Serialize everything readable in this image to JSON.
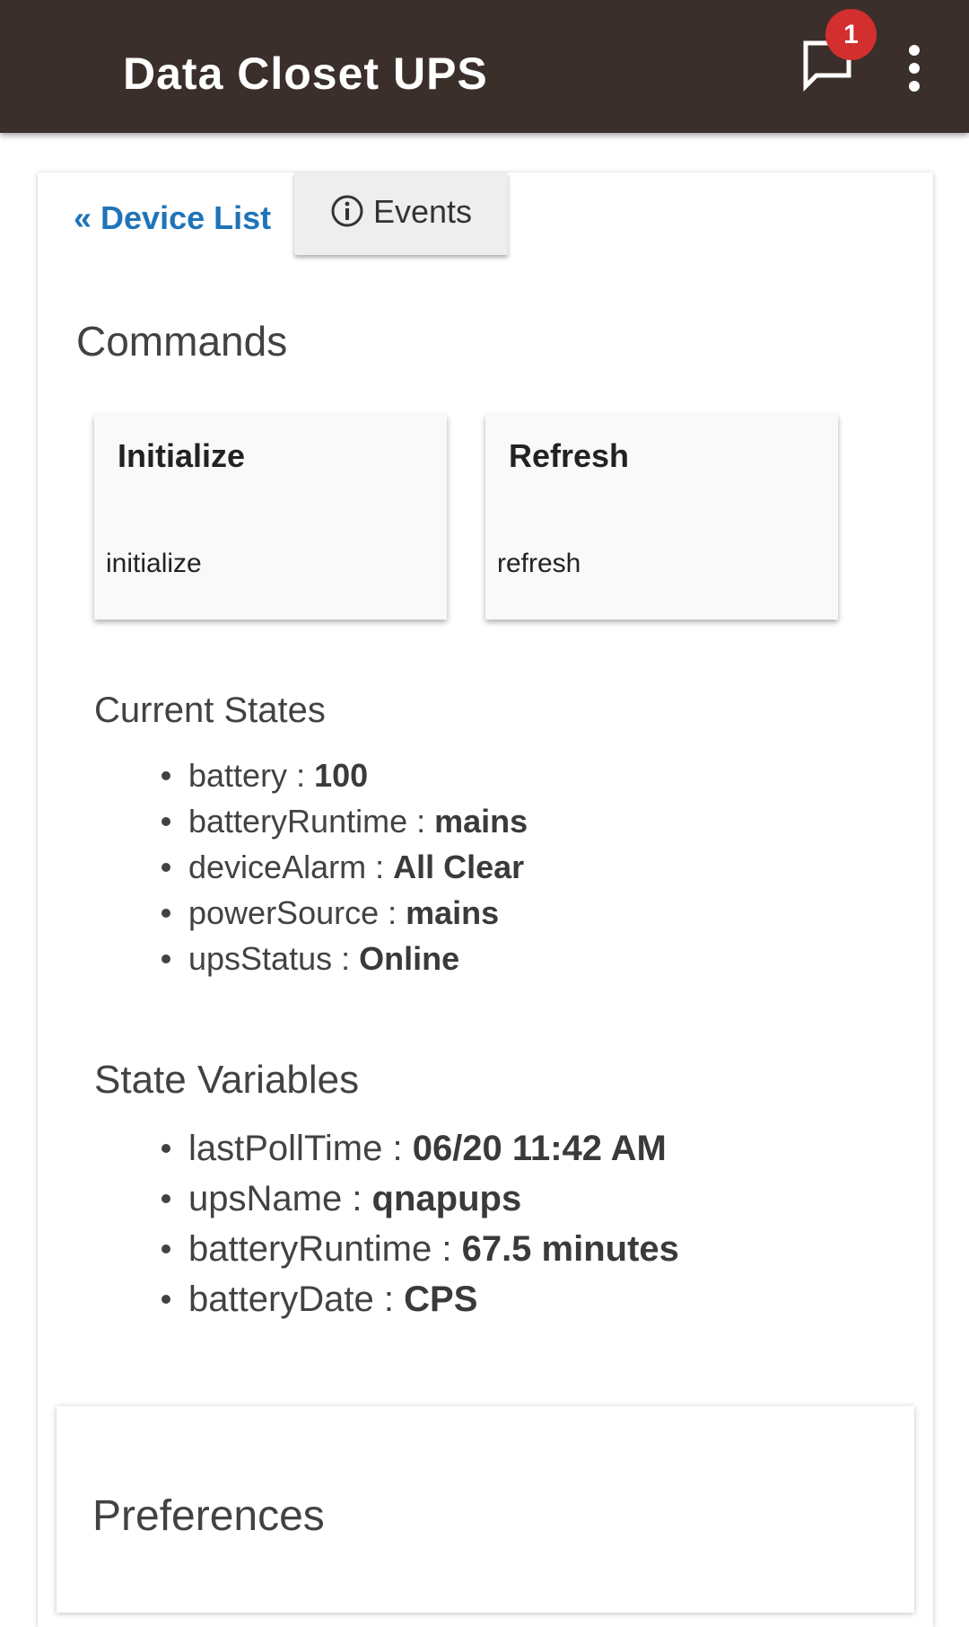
{
  "appbar": {
    "title": "Data Closet UPS",
    "notification_count": "1",
    "icons": {
      "chat": "chat-bubble-icon",
      "menu": "more-vert-icon"
    },
    "colors": {
      "background": "#3a2f2b",
      "badge": "#d32f2f"
    }
  },
  "nav": {
    "device_list_label": "« Device List",
    "events_label": "Events",
    "events_icon": "info-icon",
    "link_color": "#1f74b8"
  },
  "commands": {
    "title": "Commands",
    "items": [
      {
        "name": "Initialize",
        "method": "initialize"
      },
      {
        "name": "Refresh",
        "method": "refresh"
      }
    ]
  },
  "current_states": {
    "title": "Current States",
    "items": [
      {
        "key": "battery",
        "value": "100"
      },
      {
        "key": "batteryRuntime",
        "value": "mains"
      },
      {
        "key": "deviceAlarm",
        "value": "All Clear"
      },
      {
        "key": "powerSource",
        "value": "mains"
      },
      {
        "key": "upsStatus",
        "value": "Online"
      }
    ]
  },
  "state_variables": {
    "title": "State Variables",
    "items": [
      {
        "key": "lastPollTime",
        "value": "06/20 11:42 AM"
      },
      {
        "key": "upsName",
        "value": "qnapups"
      },
      {
        "key": "batteryRuntime",
        "value": "67.5 minutes"
      },
      {
        "key": "batteryDate",
        "value": "CPS"
      }
    ]
  },
  "preferences": {
    "title": "Preferences"
  }
}
